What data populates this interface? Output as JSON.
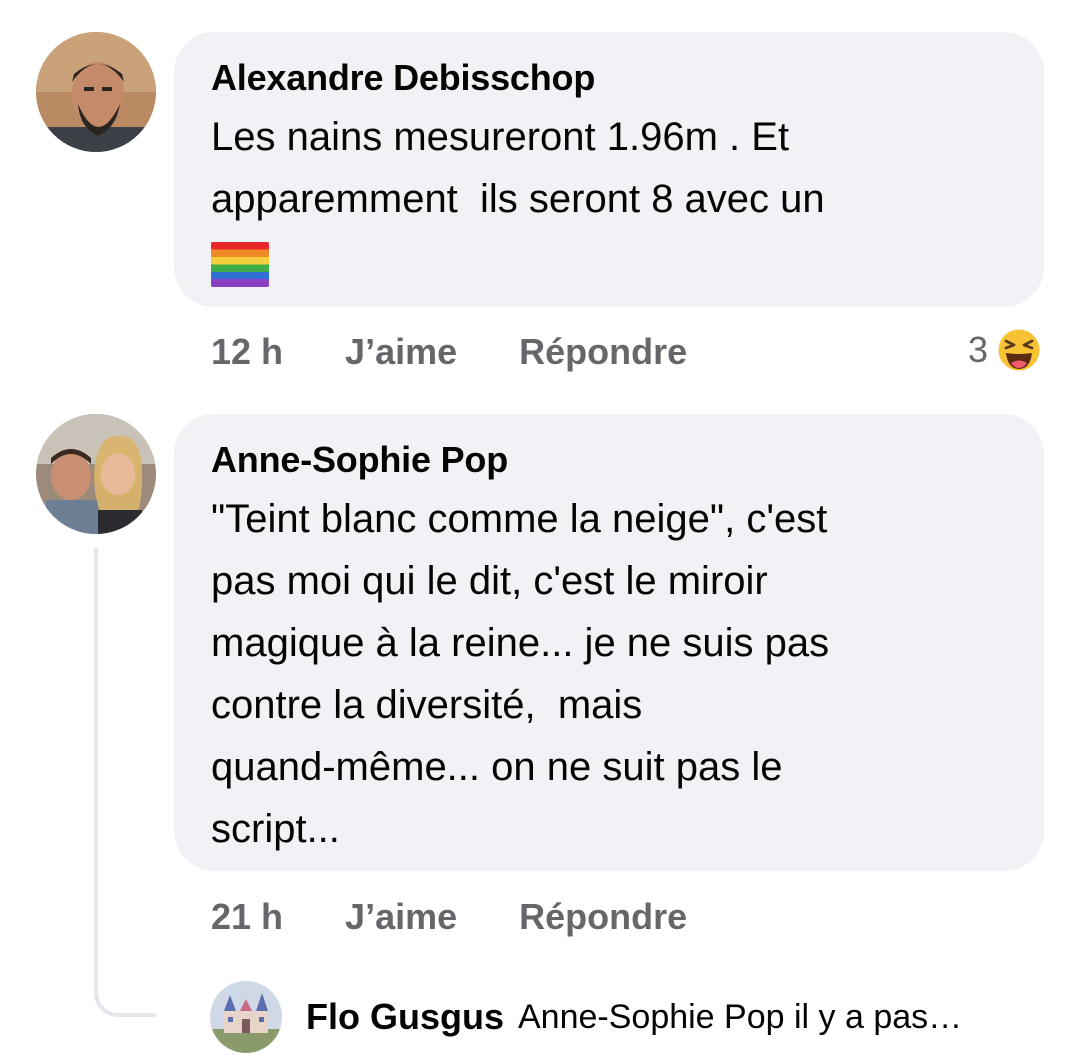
{
  "comments": [
    {
      "author": "Alexandre Debisschop",
      "text": "Les nains mesureront 1.96m . Et\napparemment  ils seront 8 avec un",
      "emoji": "rainbow-flag",
      "time": "12 h",
      "like_label": "J’aime",
      "reply_label": "Répondre",
      "reaction_count": "3",
      "reaction_icon": "laughing-emoji-icon"
    },
    {
      "author": "Anne-Sophie Pop",
      "text": "\"Teint blanc comme la neige\", c'est\npas moi qui le dit, c'est le miroir\nmagique à la reine... je ne suis pas\ncontre la diversité,  mais\nquand-même... on ne suit pas le\nscript...",
      "time": "21 h",
      "like_label": "J’aime",
      "reply_label": "Répondre"
    }
  ],
  "reply_preview": {
    "author": "Flo Gusgus",
    "text": "Anne-Sophie Pop il y a pas…"
  },
  "colors": {
    "bubble": "#f0f2f5",
    "meta_text": "#65676b",
    "thread_line": "#e4e6eb"
  }
}
